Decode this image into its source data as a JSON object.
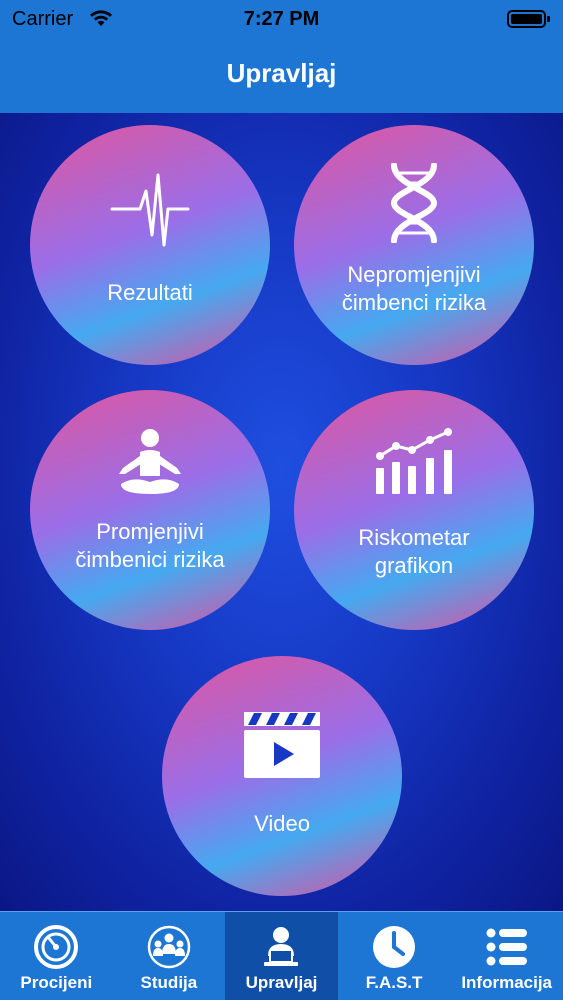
{
  "status_bar": {
    "carrier": "Carrier",
    "time": "7:27 PM",
    "icons": [
      "wifi-icon",
      "battery-icon"
    ]
  },
  "nav": {
    "title": "Upravljaj"
  },
  "tiles": [
    {
      "label_line1": "Rezultati",
      "label_line2": "",
      "icon": "heartbeat-icon"
    },
    {
      "label_line1": "Nepromjenjivi",
      "label_line2": "čimbenci rizika",
      "icon": "dna-icon"
    },
    {
      "label_line1": "Promjenjivi",
      "label_line2": "čimbenici rizika",
      "icon": "meditation-icon"
    },
    {
      "label_line1": "Riskometar",
      "label_line2": "grafikon",
      "icon": "bar-chart-icon"
    },
    {
      "label_line1": "Video",
      "label_line2": "",
      "icon": "clapperboard-icon"
    }
  ],
  "tab_bar": {
    "active_index": 2,
    "tabs": [
      {
        "label": "Procijeni",
        "icon": "gauge-icon"
      },
      {
        "label": "Studija",
        "icon": "people-icon"
      },
      {
        "label": "Upravljaj",
        "icon": "user-laptop-icon"
      },
      {
        "label": "F.A.S.T",
        "icon": "clock-icon"
      },
      {
        "label": "Informacija",
        "icon": "list-icon"
      }
    ]
  },
  "colors": {
    "bar_blue": "#1e76d4",
    "active_tab": "#0f4fa8",
    "background_deep_blue": "#0f22a0",
    "ring_pink": "#e0569e",
    "ring_blue": "#45a9f0",
    "text": "#ffffff"
  }
}
